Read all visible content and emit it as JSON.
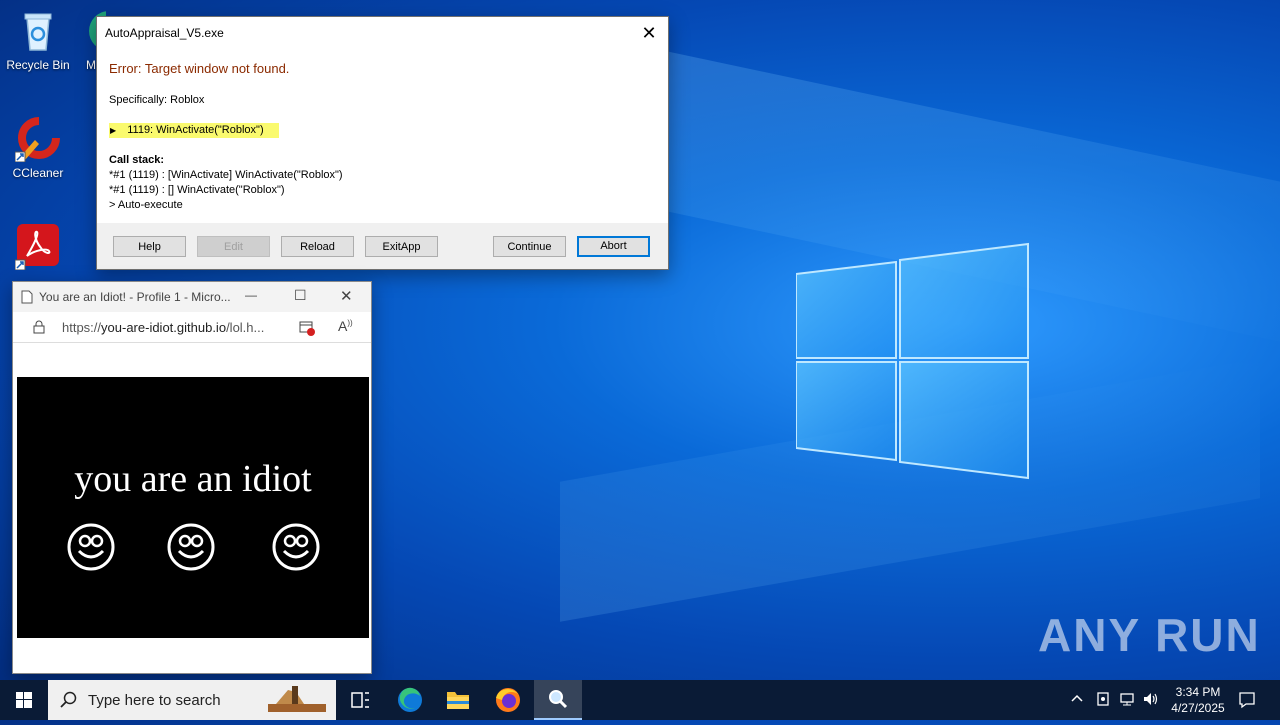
{
  "desktop": {
    "icons": [
      {
        "label": "Recycle Bin",
        "icon": "recycle-bin-icon"
      },
      {
        "label": "CCleaner",
        "icon": "ccleaner-icon"
      },
      {
        "label": "Adobe Acrobat",
        "icon": "acrobat-icon"
      },
      {
        "label": "M",
        "icon": "edge-icon"
      }
    ],
    "watermark": "ANY RUN"
  },
  "dialog": {
    "title": "AutoAppraisal_V5.exe",
    "close_label": "✕",
    "error_text": "Error: Target window not found.",
    "specifically": "Specifically: Roblox",
    "highlight_line": "1119: WinActivate(\"Roblox\")",
    "callstack_heading": "Call stack:",
    "callstack": [
      "*#1 (1119) : [WinActivate] WinActivate(\"Roblox\")",
      "*#1 (1119) : [] WinActivate(\"Roblox\")",
      "> Auto-execute"
    ],
    "buttons": {
      "help": "Help",
      "edit": "Edit",
      "reload": "Reload",
      "exitapp": "ExitApp",
      "continue": "Continue",
      "abort": "Abort"
    }
  },
  "browser": {
    "title": "You are an Idiot! - Profile 1 - Micro...",
    "url_prefix": "https://",
    "url_host": "you-are-idiot.github.io",
    "url_path": "/lol.h...",
    "page_text": "you are an idiot",
    "minimize": "—",
    "maximize": "☐",
    "close": "✕"
  },
  "taskbar": {
    "search_placeholder": "Type here to search",
    "time": "3:34 PM",
    "date": "4/27/2025",
    "apps": [
      "task-view",
      "edge",
      "file-explorer",
      "firefox",
      "search-app"
    ]
  }
}
